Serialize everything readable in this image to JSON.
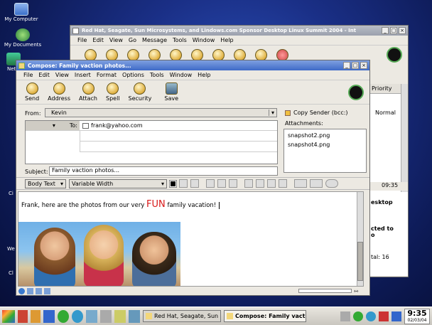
{
  "desktop": {
    "icons": [
      {
        "label": "My Computer"
      },
      {
        "label": "My Documents"
      },
      {
        "label": "Netw"
      }
    ],
    "edge_labels": [
      "Ci",
      "We",
      "Cl"
    ]
  },
  "back_window": {
    "title": "Red Hat, Seagate, Sun Microsystems, and Lindows.com Sponsor Desktop Linux Summit 2004 - Int",
    "menu": [
      "File",
      "Edit",
      "View",
      "Go",
      "Message",
      "Tools",
      "Window",
      "Help"
    ],
    "column_priority": "Priority",
    "priority_value": "Normal",
    "time": "09:35",
    "preview_lines": [
      "esktop",
      "cted to",
      "o"
    ],
    "total": "tal: 16"
  },
  "compose_window": {
    "title": "Compose: Family vaction photos...",
    "menu": [
      "File",
      "Edit",
      "View",
      "Insert",
      "Format",
      "Options",
      "Tools",
      "Window",
      "Help"
    ],
    "toolbar": [
      "Send",
      "Address",
      "Attach",
      "Spell",
      "Security",
      "Save"
    ],
    "from_label": "From:",
    "from_value": "Kevin",
    "to_label": "To:",
    "to_value": "frank@yahoo.com",
    "copy_sender": "Copy Sender (bcc:)",
    "attachments_label": "Attachments:",
    "attachments": [
      "snapshot2.png",
      "snapshot4.png"
    ],
    "subject_label": "Subject:",
    "subject_value": "Family vaction photos...",
    "format_style": "Body Text",
    "format_width": "Variable Width",
    "body_before": "Frank, here are the photos from our very ",
    "body_fun": "FUN",
    "body_after": " family vacation!"
  },
  "taskbar": {
    "tasks": [
      {
        "label": "Red Hat, Seagate, Sun Mic"
      },
      {
        "label": "Compose: Family vaction"
      }
    ],
    "clock_time": "9:35",
    "clock_date": "02/03/04"
  },
  "colors": {
    "accent": "#1e5bc6",
    "fun": "#d81818"
  }
}
